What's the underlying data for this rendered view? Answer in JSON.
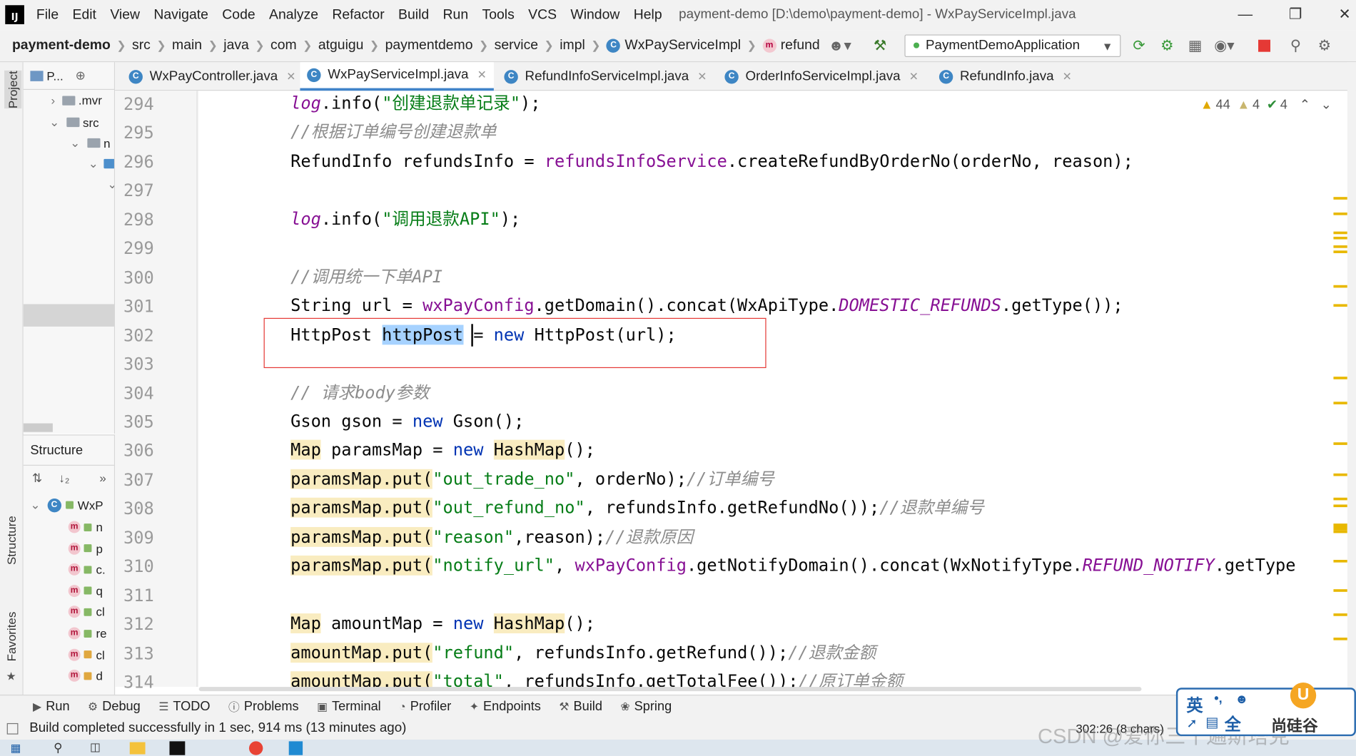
{
  "menubar": {
    "items": [
      "File",
      "Edit",
      "View",
      "Navigate",
      "Code",
      "Analyze",
      "Refactor",
      "Build",
      "Run",
      "Tools",
      "VCS",
      "Window",
      "Help"
    ],
    "title": "payment-demo [D:\\demo\\payment-demo] - WxPayServiceImpl.java"
  },
  "navbar": {
    "project": "payment-demo",
    "crumbs": [
      "src",
      "main",
      "java",
      "com",
      "atguigu",
      "paymentdemo",
      "service",
      "impl"
    ],
    "class_crumb": "WxPayServiceImpl",
    "method_crumb": "refund",
    "run_config": "PaymentDemoApplication"
  },
  "left_stripe": {
    "project": "Project",
    "structure": "Structure",
    "favorites": "Favorites"
  },
  "project_panel": {
    "title": "P...",
    "tree": [
      ".mvr",
      "src",
      "n"
    ]
  },
  "structure_panel": {
    "title": "Structure",
    "class_name": "WxP",
    "members": [
      "n",
      "p",
      "c.",
      "q",
      "cl",
      "re",
      "cl",
      "d"
    ]
  },
  "tabs": [
    {
      "label": "WxPayController.java",
      "active": false
    },
    {
      "label": "WxPayServiceImpl.java",
      "active": true
    },
    {
      "label": "RefundInfoServiceImpl.java",
      "active": false
    },
    {
      "label": "OrderInfoServiceImpl.java",
      "active": false
    },
    {
      "label": "RefundInfo.java",
      "active": false
    }
  ],
  "inspections": {
    "warnings": "44",
    "weak_warnings": "4",
    "typos": "4"
  },
  "editor": {
    "line_numbers": [
      "294",
      "295",
      "296",
      "297",
      "298",
      "299",
      "300",
      "301",
      "302",
      "303",
      "304",
      "305",
      "306",
      "307",
      "308",
      "309",
      "310",
      "311",
      "312",
      "313",
      "314"
    ],
    "lines": [
      {
        "n": "294",
        "tokens": [
          [
            "cs",
            "log"
          ],
          [
            "",
            "."
          ],
          [
            "",
            "info("
          ],
          [
            "st",
            "\"创建退款单记录\""
          ],
          [
            "",
            ");"
          ]
        ]
      },
      {
        "n": "295",
        "tokens": [
          [
            "cm",
            "//根据订单编号创建退款单"
          ]
        ]
      },
      {
        "n": "296",
        "tokens": [
          [
            "",
            "RefundInfo refundsInfo = "
          ],
          [
            "fl",
            "refundsInfoService"
          ],
          [
            "",
            ".createRefundByOrderNo(orderNo, reason);"
          ]
        ]
      },
      {
        "n": "297",
        "tokens": []
      },
      {
        "n": "298",
        "tokens": [
          [
            "cs",
            "log"
          ],
          [
            "",
            ".info("
          ],
          [
            "st",
            "\"调用退款API\""
          ],
          [
            "",
            ");"
          ]
        ]
      },
      {
        "n": "299",
        "tokens": []
      },
      {
        "n": "300",
        "tokens": [
          [
            "cm",
            "//调用统一下单API"
          ]
        ]
      },
      {
        "n": "301",
        "tokens": [
          [
            "",
            "String url = "
          ],
          [
            "fl",
            "wxPayConfig"
          ],
          [
            "",
            ".getDomain().concat(WxApiType."
          ],
          [
            "cs",
            "DOMESTIC_REFUNDS"
          ],
          [
            "",
            ".getType());"
          ]
        ]
      },
      {
        "n": "302",
        "tokens": [
          [
            "",
            "HttpPost "
          ],
          [
            "sel",
            "httpPost"
          ],
          [
            "",
            " = "
          ],
          [
            "kw",
            "new"
          ],
          [
            "",
            " HttpPost(url);"
          ]
        ]
      },
      {
        "n": "303",
        "tokens": []
      },
      {
        "n": "304",
        "tokens": [
          [
            "cm",
            "// 请求body参数"
          ]
        ]
      },
      {
        "n": "305",
        "tokens": [
          [
            "",
            "Gson gson = "
          ],
          [
            "kw",
            "new"
          ],
          [
            "",
            " Gson();"
          ]
        ]
      },
      {
        "n": "306",
        "tokens": [
          [
            "hl",
            "Map"
          ],
          [
            "",
            " paramsMap = "
          ],
          [
            "kw",
            "new"
          ],
          [
            "",
            " "
          ],
          [
            "hl",
            "HashMap"
          ],
          [
            "",
            "();"
          ]
        ]
      },
      {
        "n": "307",
        "tokens": [
          [
            "hl",
            "paramsMap.put("
          ],
          [
            "st",
            "\"out_trade_no\""
          ],
          [
            "",
            ", orderNo);"
          ],
          [
            "cm",
            "//订单编号"
          ]
        ]
      },
      {
        "n": "308",
        "tokens": [
          [
            "hl",
            "paramsMap.put("
          ],
          [
            "st",
            "\"out_refund_no\""
          ],
          [
            "",
            ", refundsInfo.getRefundNo());"
          ],
          [
            "cm",
            "//退款单编号"
          ]
        ]
      },
      {
        "n": "309",
        "tokens": [
          [
            "hl",
            "paramsMap.put("
          ],
          [
            "st",
            "\"reason\""
          ],
          [
            "",
            ",reason);"
          ],
          [
            "cm",
            "//退款原因"
          ]
        ]
      },
      {
        "n": "310",
        "tokens": [
          [
            "hl",
            "paramsMap.put("
          ],
          [
            "st",
            "\"notify_url\""
          ],
          [
            "",
            ", "
          ],
          [
            "fl",
            "wxPayConfig"
          ],
          [
            "",
            ".getNotifyDomain().concat(WxNotifyType."
          ],
          [
            "cs",
            "REFUND_NOTIFY"
          ],
          [
            "",
            ".getType"
          ]
        ]
      },
      {
        "n": "311",
        "tokens": []
      },
      {
        "n": "312",
        "tokens": [
          [
            "hl",
            "Map"
          ],
          [
            "",
            " amountMap = "
          ],
          [
            "kw",
            "new"
          ],
          [
            "",
            " "
          ],
          [
            "hl",
            "HashMap"
          ],
          [
            "",
            "();"
          ]
        ]
      },
      {
        "n": "313",
        "tokens": [
          [
            "hl",
            "amountMap.put("
          ],
          [
            "st",
            "\"refund\""
          ],
          [
            "",
            ", refundsInfo.getRefund());"
          ],
          [
            "cm",
            "//退款金额"
          ]
        ]
      },
      {
        "n": "314",
        "tokens": [
          [
            "hl",
            "amountMap.put("
          ],
          [
            "st",
            "\"total\""
          ],
          [
            "",
            ", refundsInfo.getTotalFee());"
          ],
          [
            "cm",
            "//原订单金额"
          ]
        ]
      }
    ]
  },
  "bottom_tools": [
    "Run",
    "Debug",
    "TODO",
    "Problems",
    "Terminal",
    "Profiler",
    "Endpoints",
    "Build",
    "Spring"
  ],
  "status": {
    "message": "Build completed successfully in 1 sec, 914 ms (13 minutes ago)",
    "position": "302:26 (8 chars)"
  },
  "watermark": "CSDN @爱你三千遍斯塔克",
  "ime": {
    "lang": "英",
    "mode": "全",
    "brand": "尚硅谷"
  },
  "colors": {
    "keyword": "#0033b3",
    "string": "#067d17",
    "comment": "#8c8c8c",
    "field": "#871094",
    "highlight": "#f9ecc0",
    "selection": "#a6d2ff",
    "annotation_box": "#e53935"
  }
}
